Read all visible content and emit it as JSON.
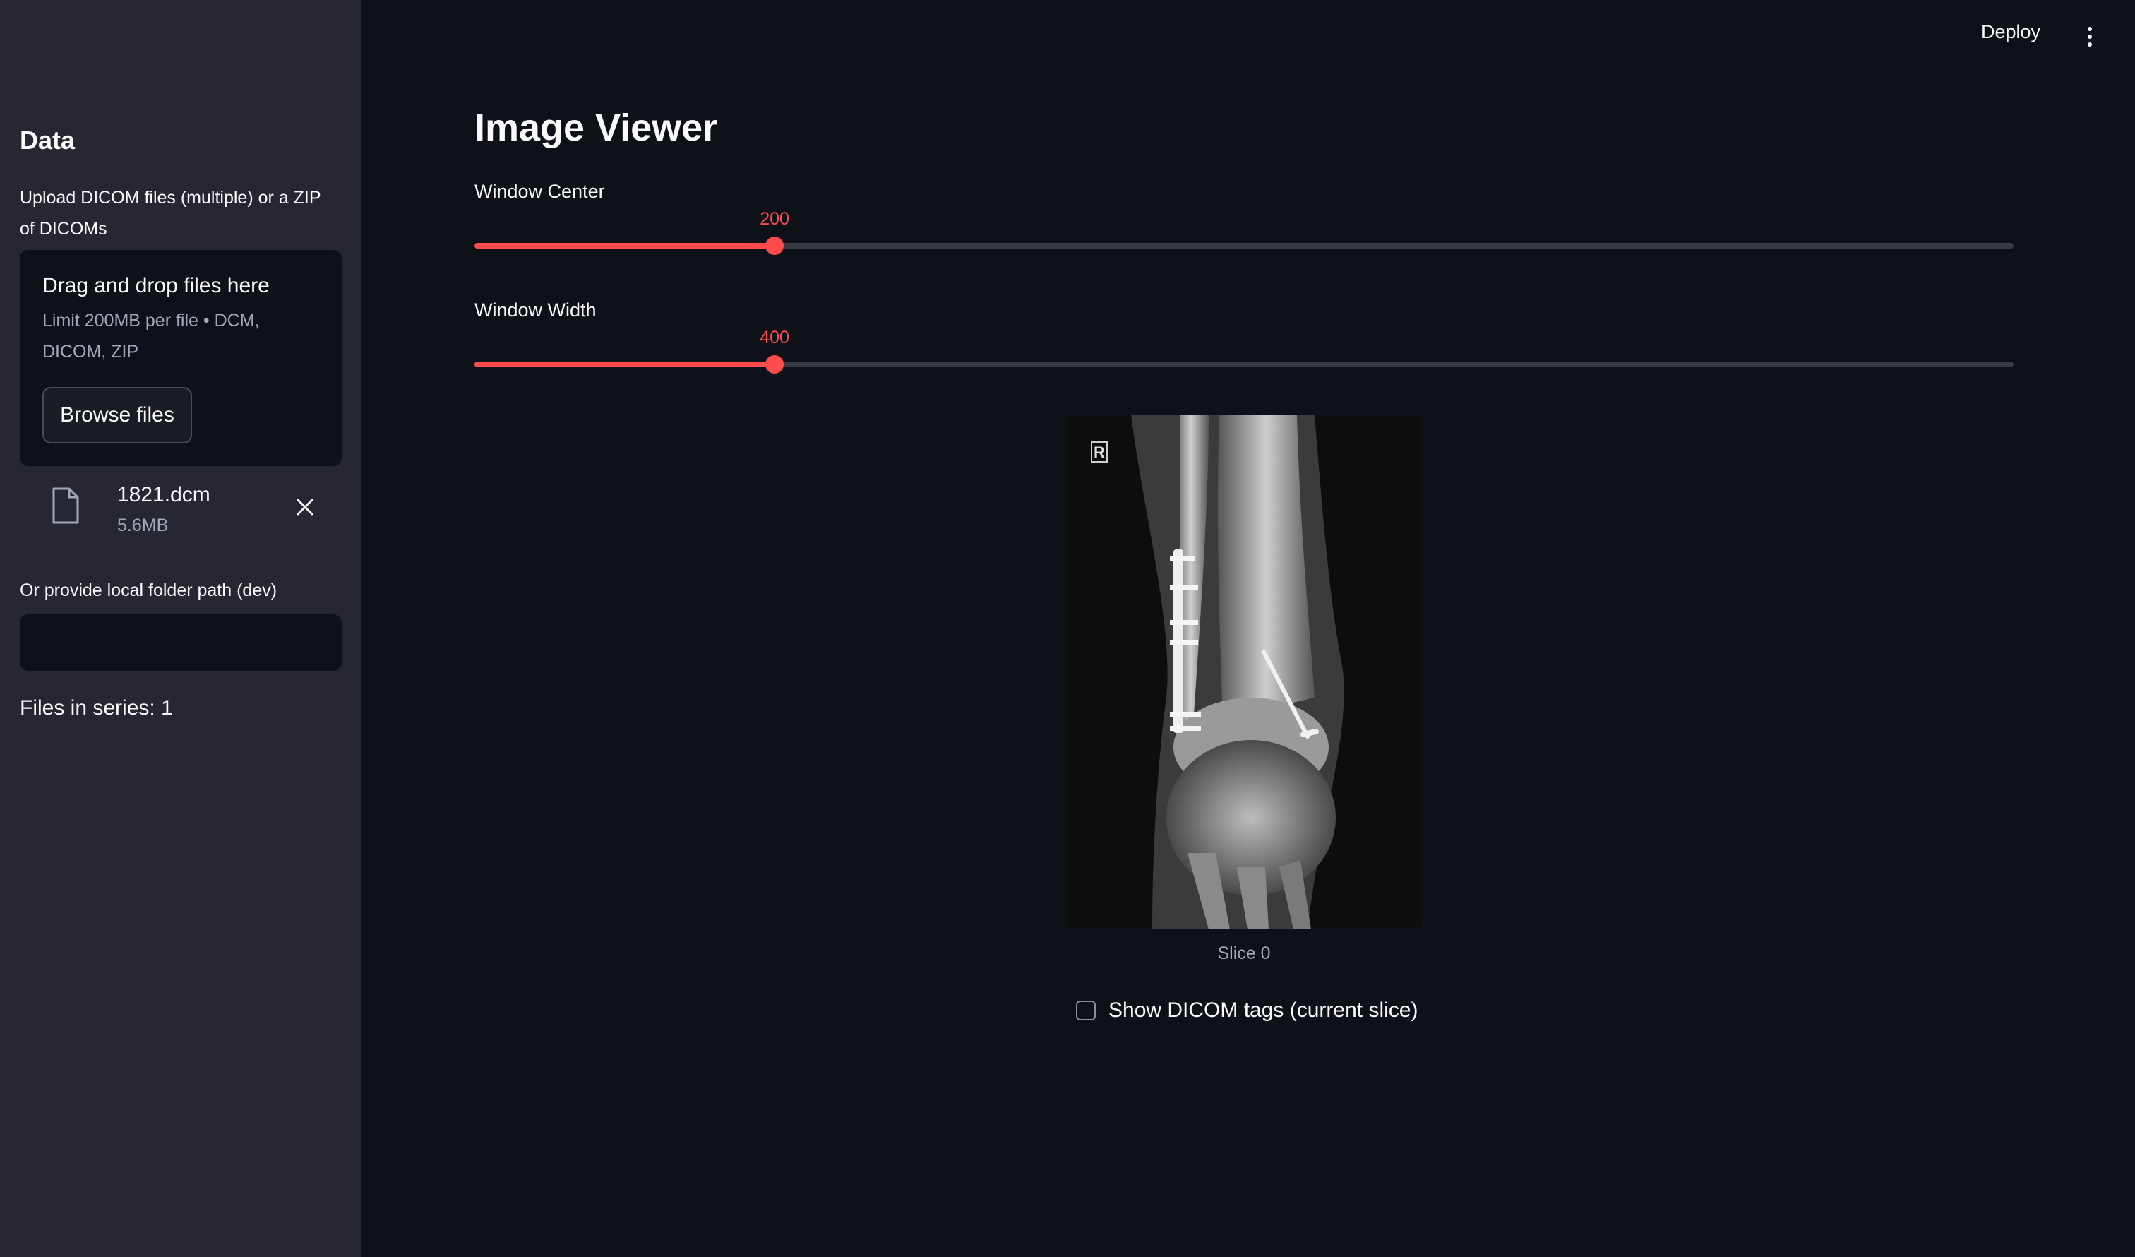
{
  "sidebar": {
    "title": "Data",
    "upload_label": "Upload DICOM files (multiple) or a ZIP of DICOMs",
    "dropzone": {
      "title": "Drag and drop files here",
      "limits": "Limit 200MB per file • DCM, DICOM, ZIP",
      "browse_label": "Browse files"
    },
    "uploaded_file": {
      "name": "1821.dcm",
      "size": "5.6MB",
      "icon": "file-icon",
      "remove_icon": "close-icon"
    },
    "folder_label": "Or provide local folder path (dev)",
    "folder_value": "",
    "files_in_series": "Files in series: 1"
  },
  "header": {
    "deploy_label": "Deploy",
    "menu_icon": "more-vertical-icon"
  },
  "main": {
    "title": "Image Viewer",
    "sliders": [
      {
        "label": "Window Center",
        "value": "200",
        "fraction": 0.195
      },
      {
        "label": "Window Width",
        "value": "400",
        "fraction": 0.195
      }
    ],
    "image_caption": "Slice 0",
    "image_marker": "R",
    "show_tags_label": "Show DICOM tags (current slice)",
    "show_tags_checked": false
  },
  "colors": {
    "accent": "#ff4b4b",
    "background": "#0e1117",
    "sidebar_bg": "#262730",
    "text": "#fafafa",
    "muted": "#a3a8b8"
  }
}
